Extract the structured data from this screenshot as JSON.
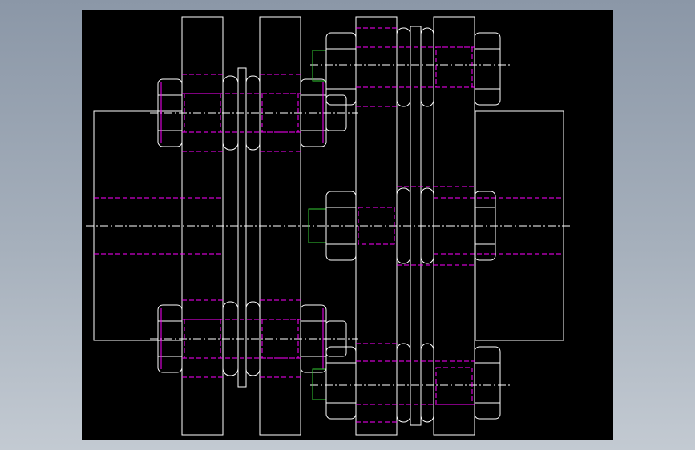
{
  "app": {
    "title": ""
  },
  "viewport": {
    "name": "cad-drawing-viewport",
    "background": "#000000"
  },
  "drawing": {
    "type": "flexible-disc-coupling-assembly",
    "view": "section",
    "colors": {
      "outline": "#ffffff",
      "hidden_line": "#ff00ff",
      "thread_end": "#33cc33",
      "centerline": "#ffffff"
    },
    "components": [
      "hub-left",
      "flange-1",
      "spacer-disc-1",
      "flange-2",
      "flange-3",
      "spacer-disc-2",
      "flange-4",
      "hub-right"
    ],
    "fasteners": {
      "hex-bolts-left": 2,
      "hex-bolts-right": 2,
      "hex-bolt-center": 1
    }
  }
}
